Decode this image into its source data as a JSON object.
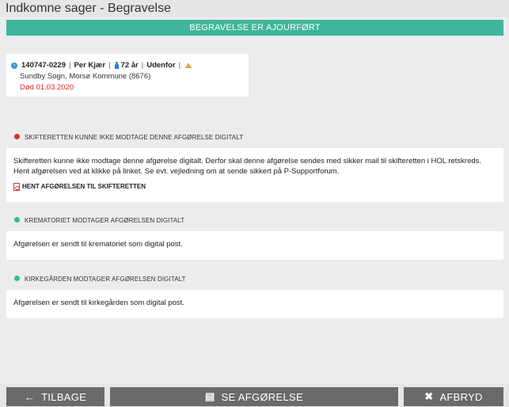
{
  "header": {
    "title": "Indkomne sager - Begravelse"
  },
  "status_banner": "BEGRAVELSE ER AJOURFØRT",
  "person": {
    "id": "140747-0229",
    "name": "Per Kjær",
    "age": "72 år",
    "location": "Udenfor",
    "parish": "Sundby Sogn, Morsø Kommune (8676)",
    "death": "Død 01.03.2020"
  },
  "sections": [
    {
      "heading": "SKIFTERETTEN KUNNE IKKE MODTAGE DENNE AFGØRELSE DIGITALT",
      "status": "error",
      "body": "Skifteretten kunne ikke modtage denne afgørelse digitalt. Derfor skal denne afgørelse sendes med sikker mail til skifteretten i HOL retskreds. Hent afgørelsen ved at klikke på linket. Se evt. vejledning om at sende sikkert på P-Supportforum.",
      "link": "HENT AFGØRELSEN TIL SKIFTERETTEN"
    },
    {
      "heading": "KREMATORIET MODTAGER AFGØRELSEN DIGITALT",
      "status": "ok",
      "body": "Afgørelsen er sendt til krematoriet som digital post."
    },
    {
      "heading": "KIRKEGÅRDEN MODTAGER AFGØRELSEN DIGITALT",
      "status": "ok",
      "body": "Afgørelsen er sendt til kirkegården som digital post."
    }
  ],
  "footer": {
    "back_label": "TILBAGE",
    "view_label": "SE AFGØRELSE",
    "cancel_label": "AFBRYD"
  },
  "colors": {
    "accent": "#3eb69b",
    "error": "#d9302c",
    "death": "#e0231c",
    "button": "#6a6a6a"
  }
}
